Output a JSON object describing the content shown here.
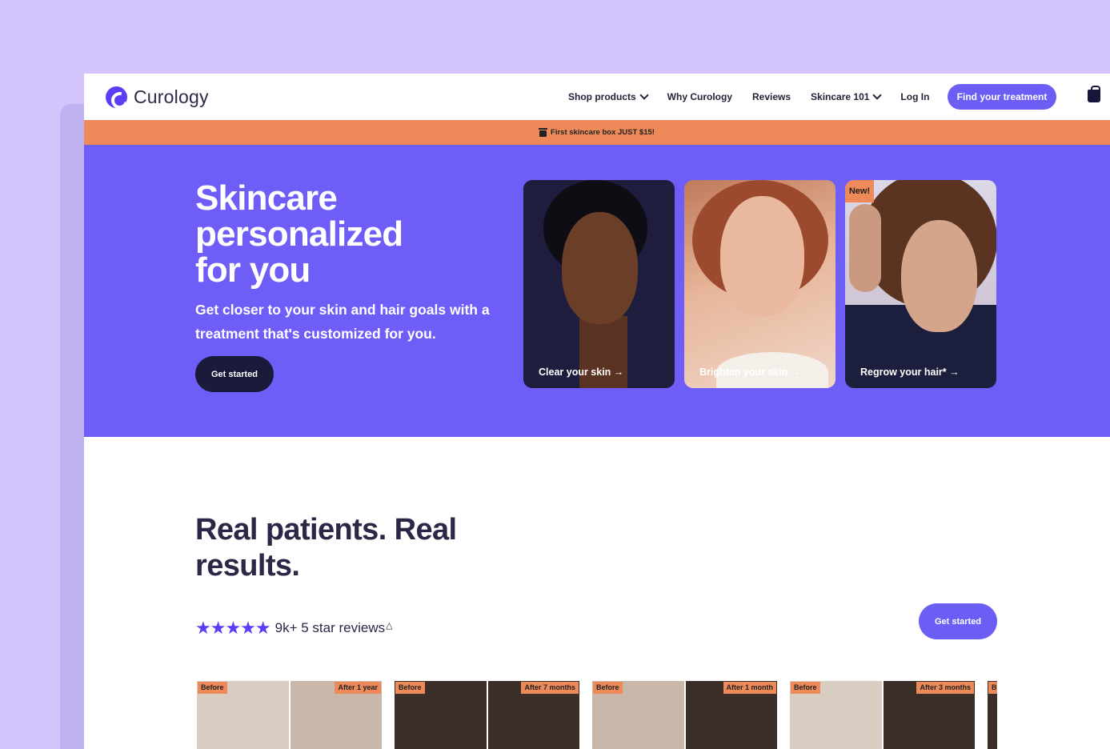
{
  "brand": {
    "name": "Curology",
    "accent": "#6c5ef5",
    "promo_color": "#ee8a5a",
    "hero_color": "#6e5df6"
  },
  "nav": {
    "items": [
      {
        "label": "Shop products",
        "dropdown": true
      },
      {
        "label": "Why Curology",
        "dropdown": false
      },
      {
        "label": "Reviews",
        "dropdown": false
      },
      {
        "label": "Skincare 101",
        "dropdown": true
      },
      {
        "label": "Log In",
        "dropdown": false
      }
    ],
    "cta": "Find your treatment",
    "cart_icon": "shopping-bag-icon"
  },
  "promo": {
    "text": "First skincare box JUST $15!",
    "icon": "gift-icon"
  },
  "hero": {
    "title": "Skincare personalized for you",
    "subtitle": "Get closer to your skin and hair goals with a treatment that's customized for you.",
    "button": "Get started",
    "cards": [
      {
        "label": "Clear your skin →"
      },
      {
        "label": "Brighten your skin →"
      },
      {
        "label": "Regrow your hair* →",
        "badge": "New!"
      }
    ]
  },
  "results": {
    "title": "Real patients. Real results.",
    "stars": "★★★★★",
    "rating_text": "9k+ 5 star reviews",
    "footnote_mark": "△",
    "button": "Get started",
    "before_after": [
      {
        "before": "Before",
        "after": "After 1 year"
      },
      {
        "before": "Before",
        "after": "After 7 months"
      },
      {
        "before": "Before",
        "after": "After 1 month"
      },
      {
        "before": "Before",
        "after": "After 3 months"
      },
      {
        "before": "B",
        "after": ""
      }
    ]
  }
}
